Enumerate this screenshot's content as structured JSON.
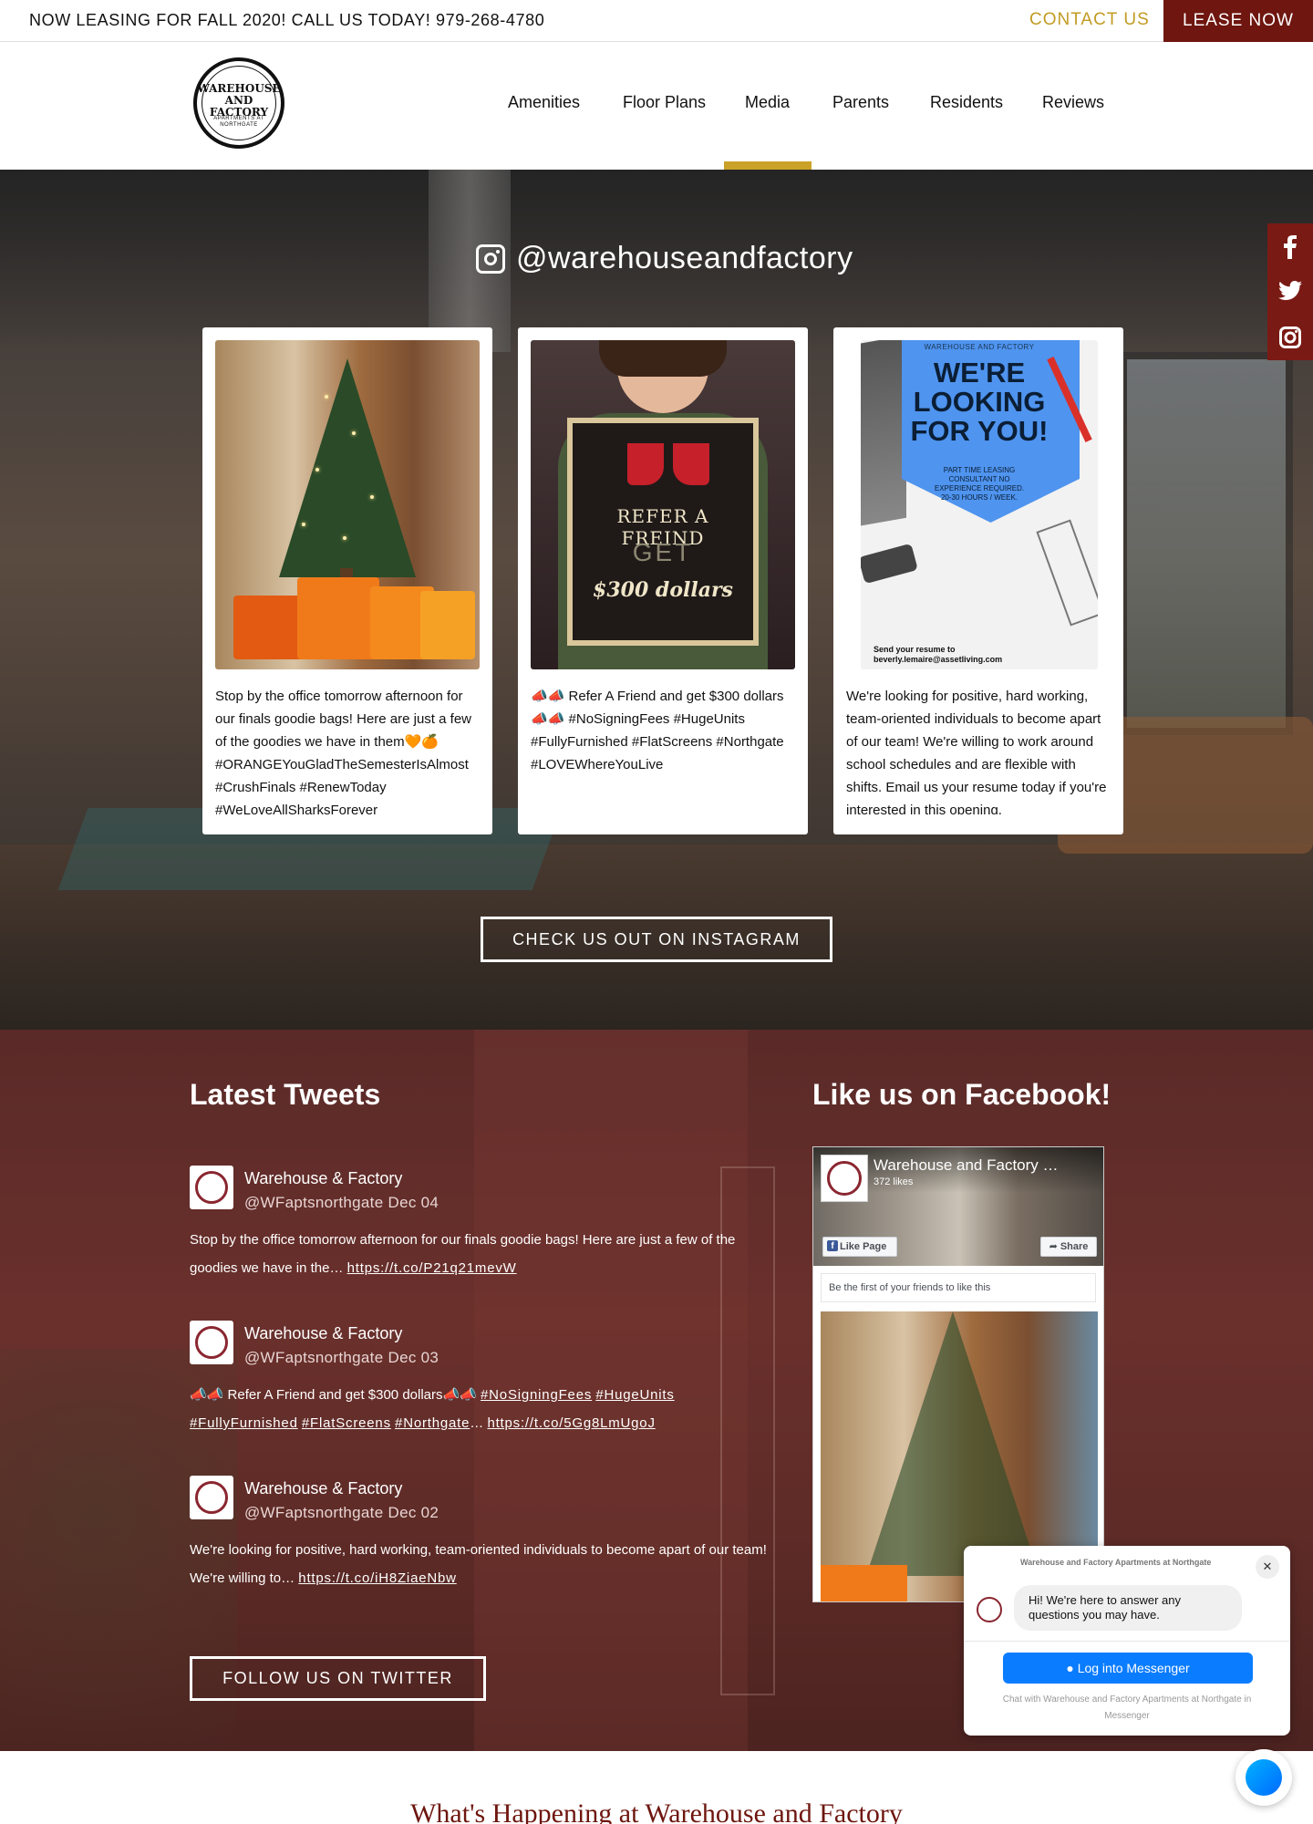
{
  "topbar": {
    "promo": "NOW LEASING FOR FALL 2020! CALL US TODAY! 979-268-4780",
    "contact": "CONTACT US",
    "lease": "LEASE NOW"
  },
  "logo": {
    "line1": "WAREHOUSE",
    "line2": "AND FACTORY",
    "line3": "APARTMENTS AT",
    "line4": "NORTHGATE"
  },
  "nav": {
    "items": [
      "Amenities",
      "Floor Plans",
      "Media",
      "Parents",
      "Residents",
      "Reviews"
    ],
    "active": "Media"
  },
  "instagram": {
    "handle": "@warehouseandfactory",
    "cta": "CHECK US OUT ON INSTAGRAM",
    "posts": [
      {
        "caption": "Stop by the office tomorrow afternoon for our finals goodie bags! Here are just a few of the goodies we have in them🧡🍊 #ORANGEYouGladTheSemesterIsAlmost #CrushFinals #RenewToday #WeLoveAllSharksForever"
      },
      {
        "caption": "📣📣 Refer A Friend and get $300 dollars📣📣 #NoSigningFees #HugeUnits #FullyFurnished #FlatScreens #Northgate #LOVEWhereYouLive",
        "sign_line1": "REFER A FREIND",
        "sign_line2": "GET",
        "sign_line3": "$300 dollars"
      },
      {
        "caption": "We're looking for positive, hard working, team-oriented individuals to become apart of our team! We're willing to work around school schedules and are flexible with shifts. Email us your resume today if you're interested in this opening.",
        "flyer_brand": "WAREHOUSE AND FACTORY",
        "flyer_title": "WE'RE LOOKING FOR YOU!",
        "flyer_detail": "PART TIME LEASING CONSULTANT NO EXPERIENCE REQUIRED. 20-30 HOURS / WEEK.",
        "flyer_contact": "Send your resume to beverly.lemaire@assetliving.com"
      }
    ]
  },
  "social_rail": [
    "facebook-icon",
    "twitter-icon",
    "instagram-icon"
  ],
  "tweets": {
    "title": "Latest Tweets",
    "cta": "FOLLOW US ON TWITTER",
    "items": [
      {
        "name": "Warehouse & Factory",
        "handle": "@WFaptsnorthgate",
        "date": "Dec 04",
        "text": "Stop by the office tomorrow afternoon for our finals goodie bags! Here are just a few of the goodies we have in the… ",
        "link": "https://t.co/P21q21mevW"
      },
      {
        "name": "Warehouse & Factory",
        "handle": "@WFaptsnorthgate",
        "date": "Dec 03",
        "text": "📣📣 Refer A Friend and get $300 dollars📣📣 ",
        "tags1": "#NoSigningFees",
        "tags2": "#HugeUnits",
        "tags3": "#FullyFurnished",
        "tags4": "#FlatScreens",
        "tags5": "#Northgate",
        "ellipsis": "… ",
        "link": "https://t.co/5Gg8LmUgoJ"
      },
      {
        "name": "Warehouse & Factory",
        "handle": "@WFaptsnorthgate",
        "date": "Dec 02",
        "text": "We're looking for positive, hard working, team-oriented individuals to become apart of our team! We're willing to… ",
        "link": "https://t.co/iH8ZiaeNbw"
      }
    ]
  },
  "facebook": {
    "title": "Like us on Facebook!",
    "page_name": "Warehouse and Factory …",
    "likes": "372 likes",
    "like_button": "Like Page",
    "share_button": "Share",
    "friends_note": "Be the first of your friends to like this"
  },
  "messenger": {
    "header": "Warehouse and Factory Apartments at Northgate",
    "greeting": "Hi! We're here to answer any questions you may have.",
    "login": "Log into Messenger",
    "footer": "Chat with Warehouse and Factory Apartments at Northgate in Messenger"
  },
  "happening": {
    "title": "What's Happening at Warehouse and Factory"
  },
  "colors": {
    "maroon": "#6e160f",
    "gold": "#c29b23",
    "messenger_blue": "#0a7cff"
  }
}
